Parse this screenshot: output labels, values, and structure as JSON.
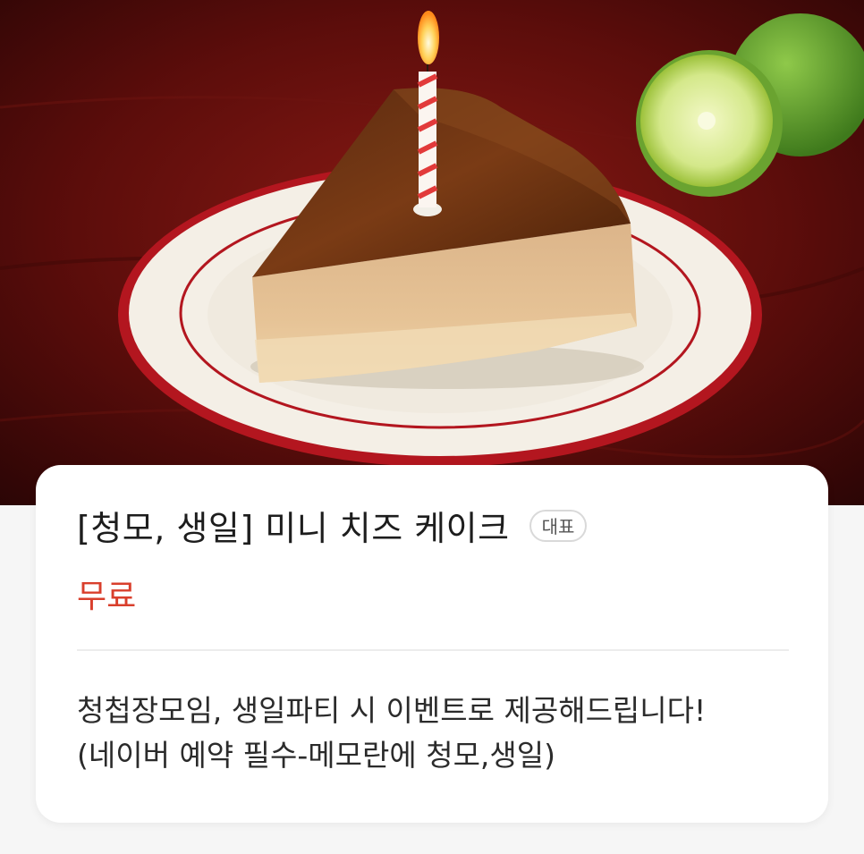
{
  "menu_item": {
    "title": "[청모, 생일] 미니 치즈 케이크",
    "badge": "대표",
    "price": "무료",
    "description_lines": [
      "청첩장모임, 생일파티 시 이벤트로 제공해드립니다!",
      "(네이버 예약 필수-메모란에 청모,생일)"
    ]
  },
  "photo": {
    "subject": "cheesecake-slice-with-candle"
  },
  "colors": {
    "price_red": "#d93f2c",
    "plate_rim_red": "#b3161f",
    "background_wood": "#5a0c0c"
  }
}
